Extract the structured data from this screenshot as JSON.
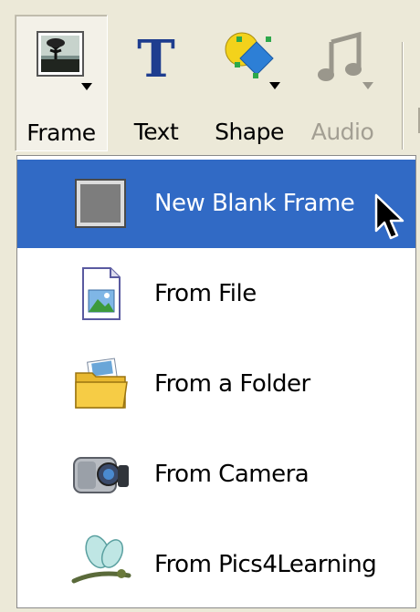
{
  "toolbar": {
    "buttons": [
      {
        "label": "Frame",
        "icon": "frame-photo-icon",
        "state": "pressed"
      },
      {
        "label": "Text",
        "icon": "text-t-icon",
        "state": "normal"
      },
      {
        "label": "Shape",
        "icon": "shape-icon",
        "state": "normal"
      },
      {
        "label": "Audio",
        "icon": "music-note-icon",
        "state": "disabled"
      }
    ]
  },
  "menu": {
    "items": [
      {
        "label": "New Blank Frame",
        "icon": "blank-frame-icon",
        "highlighted": true
      },
      {
        "label": "From File",
        "icon": "image-file-icon",
        "highlighted": false
      },
      {
        "label": "From a Folder",
        "icon": "folder-icon",
        "highlighted": false
      },
      {
        "label": "From Camera",
        "icon": "camera-icon",
        "highlighted": false
      },
      {
        "label": "From Pics4Learning",
        "icon": "dragonfly-icon",
        "highlighted": false
      }
    ]
  },
  "colors": {
    "toolbar_bg": "#ece9d8",
    "highlight": "#316ac5",
    "text_blue": "#1e3d8f",
    "disabled": "#a39f93"
  }
}
